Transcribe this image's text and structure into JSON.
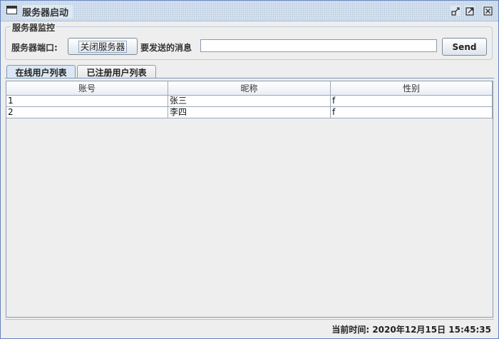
{
  "window": {
    "title": "服务器启动",
    "controls": [
      "minimize-icon",
      "maximize-icon",
      "close-icon"
    ]
  },
  "server_monitor": {
    "group_title": "服务器监控",
    "port_label": "服务器端口:",
    "close_button_label": "关闭服务器",
    "message_label": "要发送的消息",
    "message_value": "",
    "send_button_label": "Send"
  },
  "tabs": [
    {
      "label": "在线用户列表",
      "selected": true
    },
    {
      "label": "已注册用户列表",
      "selected": false
    }
  ],
  "table": {
    "columns": [
      "账号",
      "昵称",
      "性别"
    ],
    "rows": [
      [
        "1",
        "张三",
        "f"
      ],
      [
        "2",
        "李四",
        "f"
      ]
    ]
  },
  "status": {
    "text": "当前时间: 2020年12月15日 15:45:35"
  }
}
